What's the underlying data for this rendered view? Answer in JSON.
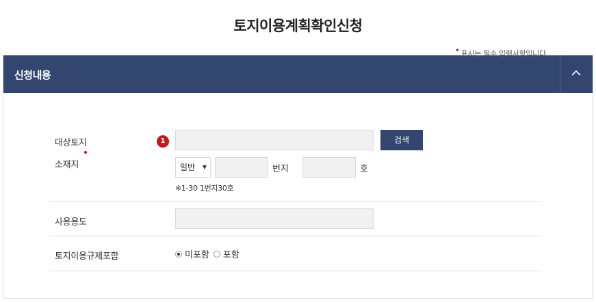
{
  "page": {
    "title": "토지이용계획확인신청"
  },
  "panel": {
    "title": "신청내용"
  },
  "required_note": {
    "marker": "•",
    "text": "표시는 필수 입력사항입니다."
  },
  "location": {
    "label_line1": "대상토지",
    "label_line2": "소재지",
    "step_badge": "1",
    "address_value": "",
    "search_button": "검색",
    "land_type_selected": "일반",
    "bunji_value": "",
    "bunji_unit": "번지",
    "ho_value": "",
    "ho_unit": "호",
    "hint": "※1-30 1번지30호"
  },
  "usage": {
    "label": "사용용도",
    "value": ""
  },
  "regulation": {
    "label": "토지이용규제포함",
    "options": [
      {
        "label": "미포함",
        "checked": true
      },
      {
        "label": "포함",
        "checked": false
      }
    ]
  },
  "colors": {
    "header_bg": "#32466f",
    "required_red": "#d0111b",
    "input_bg": "#f1f1f1"
  },
  "icons": {
    "collapse": "chevron-up-icon",
    "select": "caret-down-icon"
  }
}
